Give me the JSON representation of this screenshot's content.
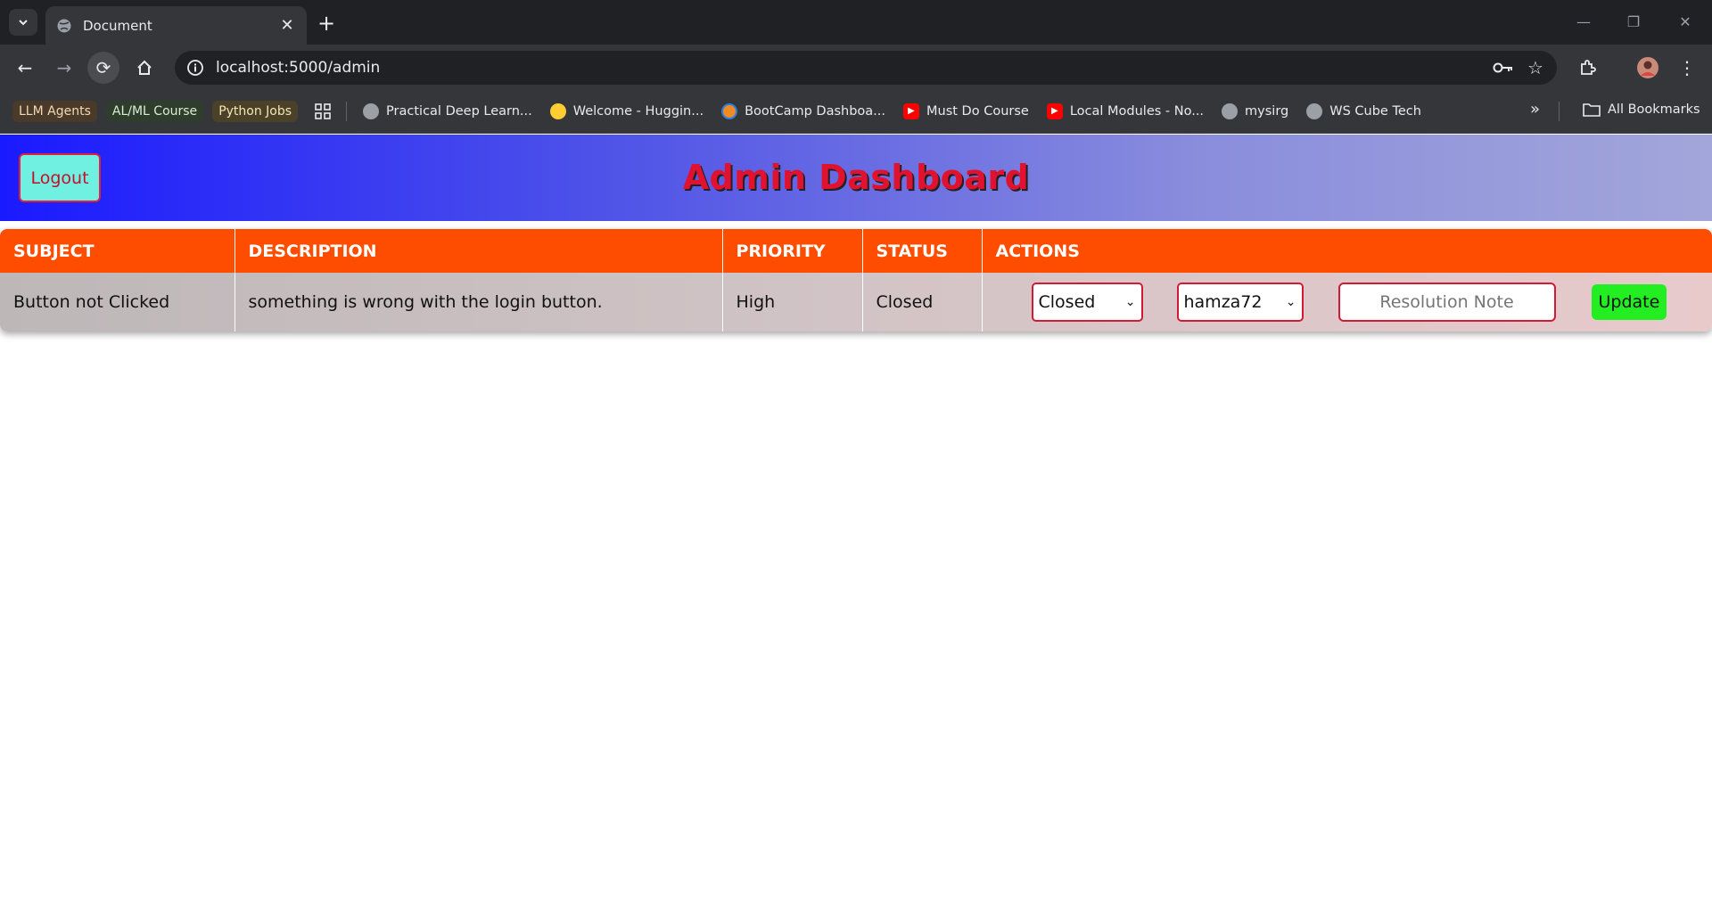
{
  "browser": {
    "tab_title": "Document",
    "url": "localhost:5000/admin",
    "bookmarks_chips": [
      {
        "label": "LLM Agents",
        "bg": "#4a3a2a",
        "color": "#f2d9b3"
      },
      {
        "label": "AL/ML Course",
        "bg": "#2e3d2c",
        "color": "#d8ecd0"
      },
      {
        "label": "Python Jobs",
        "bg": "#4a4128",
        "color": "#f4e6b0"
      }
    ],
    "bookmarks": [
      {
        "label": "Practical Deep Learn...",
        "icon": "globe-icon"
      },
      {
        "label": "Welcome - Huggin...",
        "icon": "hugging-face-icon"
      },
      {
        "label": "BootCamp Dashboa...",
        "icon": "bootcamp-icon"
      },
      {
        "label": "Must Do Course",
        "icon": "youtube-icon"
      },
      {
        "label": "Local Modules - No...",
        "icon": "youtube-icon"
      },
      {
        "label": "mysirg",
        "icon": "globe-icon"
      },
      {
        "label": "WS Cube Tech",
        "icon": "globe-icon"
      }
    ],
    "all_bookmarks": "All Bookmarks"
  },
  "header": {
    "logout_label": "Logout",
    "title": "Admin Dashboard"
  },
  "table": {
    "columns": [
      "SUBJECT",
      "DESCRIPTION",
      "PRIORITY",
      "STATUS",
      "ACTIONS"
    ],
    "rows": [
      {
        "subject": "Button not Clicked",
        "description": "something is wrong with the login button.",
        "priority": "High",
        "status": "Closed",
        "status_select": "Closed",
        "assignee_select": "hamza72",
        "note_placeholder": "Resolution Note",
        "update_label": "Update"
      }
    ]
  },
  "colors": {
    "header_gradient_start": "#1a1aff",
    "header_gradient_end": "#a2a6da",
    "table_header": "#ff4d00",
    "accent_red": "#e1122f",
    "update_button": "#22ee22",
    "logout_button": "#6ff0e0"
  }
}
